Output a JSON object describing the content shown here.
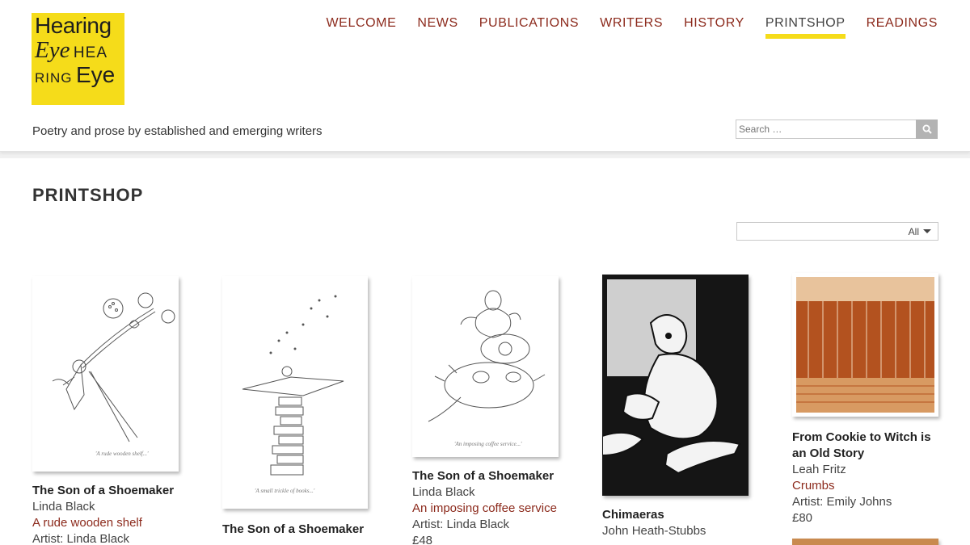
{
  "site": {
    "logo_line1": "Hearing",
    "logo_line2_italic": "Eye",
    "logo_line2_caps": "HEA",
    "logo_line3_caps": "RING",
    "logo_line3_big": "Eye",
    "tagline": "Poetry and prose by established and emerging writers"
  },
  "nav": [
    {
      "label": "WELCOME"
    },
    {
      "label": "NEWS"
    },
    {
      "label": "PUBLICATIONS"
    },
    {
      "label": "WRITERS"
    },
    {
      "label": "HISTORY"
    },
    {
      "label": "PRINTSHOP"
    },
    {
      "label": "READINGS"
    }
  ],
  "nav_active": "PRINTSHOP",
  "search": {
    "placeholder": "Search …"
  },
  "page": {
    "title": "PRINTSHOP"
  },
  "filter": {
    "selected": "All"
  },
  "products": [
    {
      "title": "The Son of a Shoemaker",
      "author": "Linda Black",
      "work": "A rude wooden shelf",
      "artist": "Artist: Linda Black",
      "price": ""
    },
    {
      "title": "The Son of a Shoemaker",
      "author": "",
      "work": "",
      "artist": "",
      "price": ""
    },
    {
      "title": "The Son of a Shoemaker",
      "author": "Linda Black",
      "work": "An imposing coffee service",
      "artist": "Artist: Linda Black",
      "price": "£48"
    },
    {
      "title": "Chimaeras",
      "author": "John Heath-Stubbs",
      "work": "",
      "artist": "",
      "price": ""
    },
    {
      "title": "From Cookie to Witch is an Old Story",
      "author": "Leah Fritz",
      "work": "Crumbs",
      "artist": "Artist: Emily Johns",
      "price": "£80"
    }
  ],
  "colors": {
    "accent": "#f5dc1a",
    "link": "#8c2a1c",
    "print_rust": "#b3521f"
  },
  "icons": {
    "search": "magnifier-icon",
    "dropdown": "caret-down-icon"
  }
}
